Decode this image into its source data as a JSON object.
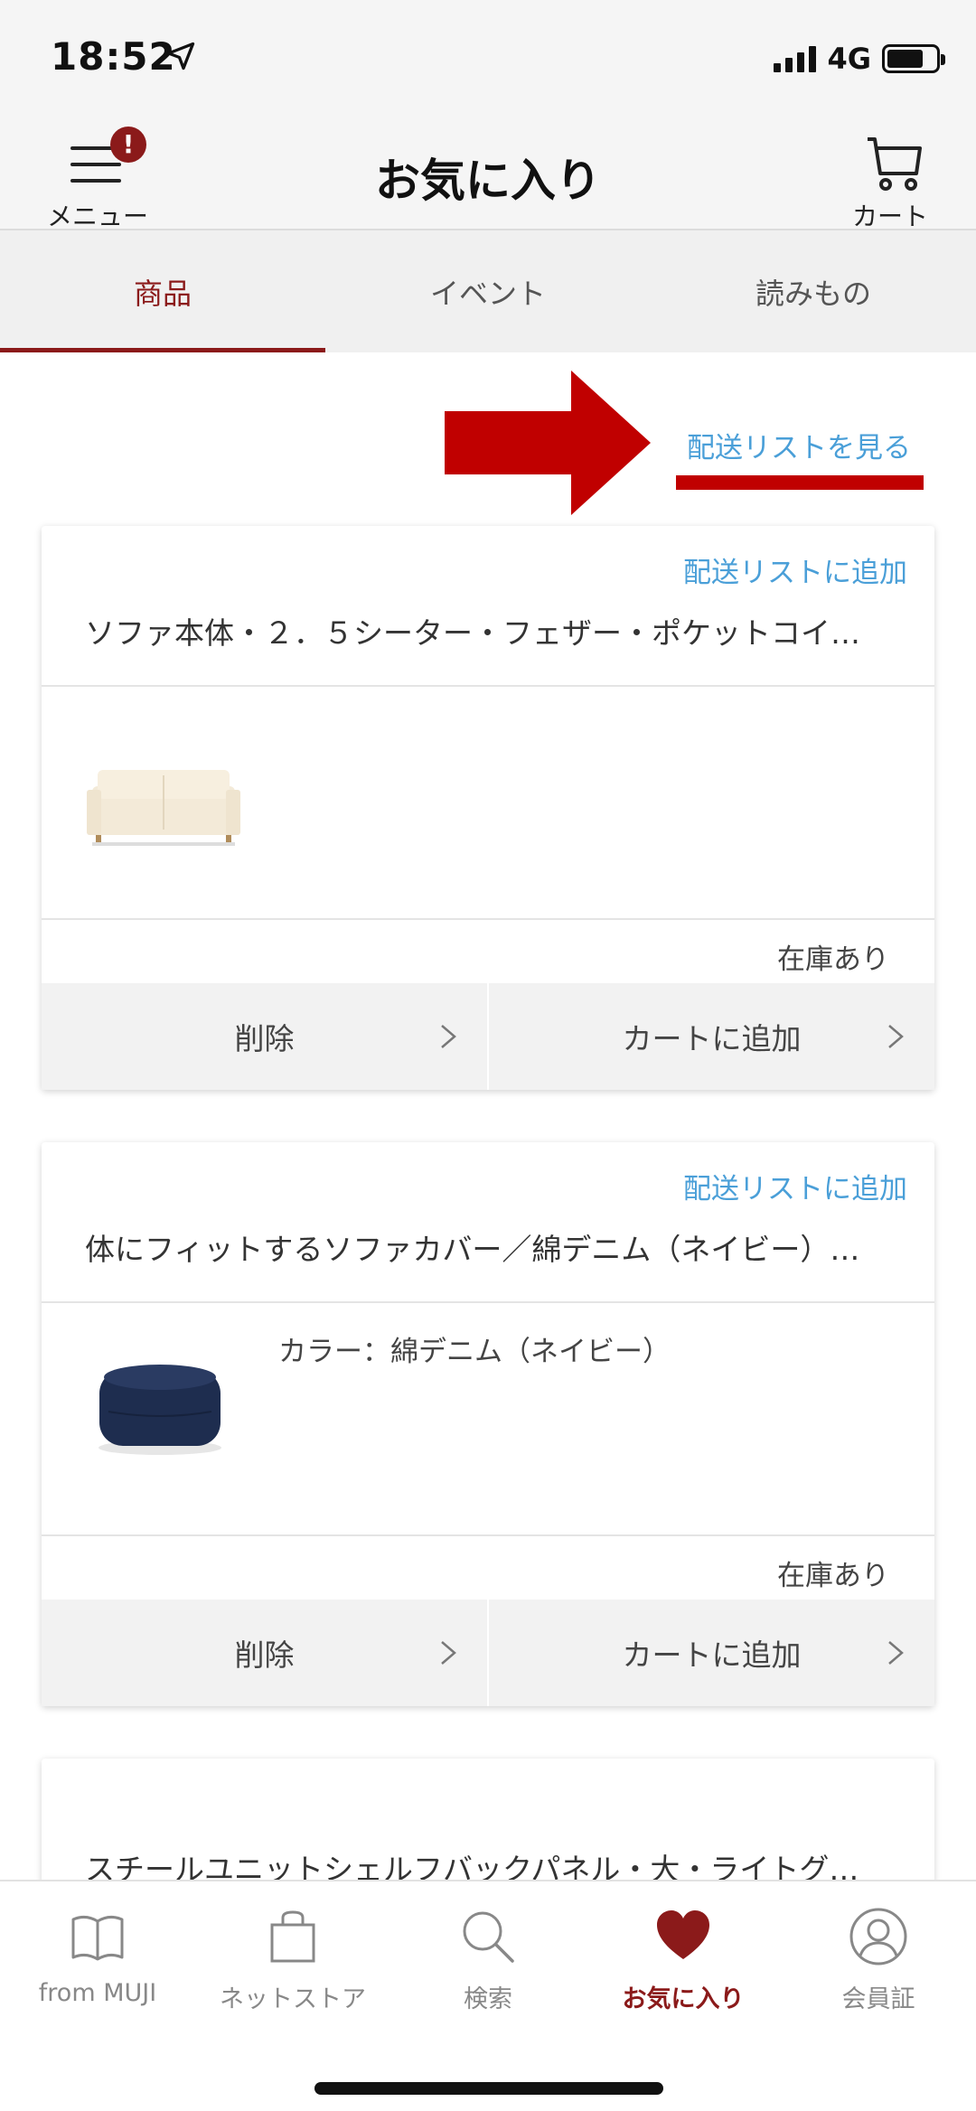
{
  "status": {
    "time": "18:52",
    "network": "4G"
  },
  "header": {
    "menu_label": "メニュー",
    "menu_badge": "!",
    "title": "お気に入り",
    "cart_label": "カート"
  },
  "tabs": [
    {
      "label": "商品",
      "active": true
    },
    {
      "label": "イベント",
      "active": false
    },
    {
      "label": "読みもの",
      "active": false
    }
  ],
  "shipping_link": "配送リストを見る",
  "colors": {
    "accent": "#8b1a1a",
    "link": "#4a9fd8",
    "annotation": "#c00000"
  },
  "items": [
    {
      "add_to_shipping": "配送リストに追加",
      "title": "ソファ本体・２．５シーター・フェザー・ポケットコイ…",
      "variant": "",
      "stock": "在庫あり",
      "delete_label": "削除",
      "add_cart_label": "カートに追加",
      "image": "sofa-image"
    },
    {
      "add_to_shipping": "配送リストに追加",
      "title": "体にフィットするソファカバー／綿デニム（ネイビー）…",
      "variant": "カラー：綿デニム（ネイビー）",
      "stock": "在庫あり",
      "delete_label": "削除",
      "add_cart_label": "カートに追加",
      "image": "denim-cushion-image"
    },
    {
      "title": "スチールユニットシェルフバックパネル・大・ライトグ…"
    }
  ],
  "bottom_nav": [
    {
      "label": "from MUJI",
      "icon": "book-icon"
    },
    {
      "label": "ネットストア",
      "icon": "shopping-bag-icon"
    },
    {
      "label": "検索",
      "icon": "search-icon"
    },
    {
      "label": "お気に入り",
      "icon": "heart-icon",
      "active": true
    },
    {
      "label": "会員証",
      "icon": "member-icon"
    }
  ]
}
